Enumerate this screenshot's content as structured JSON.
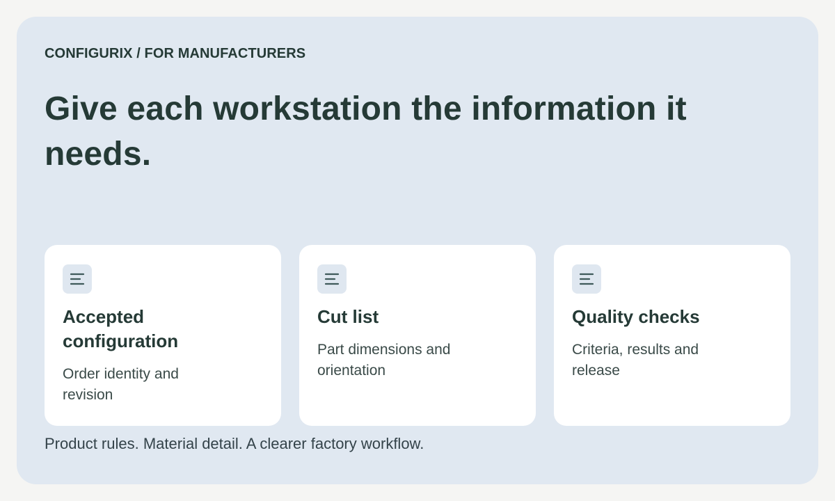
{
  "header": {
    "eyebrow": "CONFIGURIX / FOR MANUFACTURERS",
    "headline": "Give each workstation the information it needs."
  },
  "cards": [
    {
      "icon": "list-lines-icon",
      "title": "Accepted configuration",
      "description": "Order identity and revision"
    },
    {
      "icon": "list-lines-icon",
      "title": "Cut list",
      "description": "Part dimensions and orientation"
    },
    {
      "icon": "list-lines-icon",
      "title": "Quality checks",
      "description": "Criteria, results and release"
    }
  ],
  "footer": {
    "tagline": "Product rules. Material detail. A clearer factory workflow."
  },
  "colors": {
    "page_background": "#f5f5f3",
    "panel_background": "#e0e8f1",
    "card_background": "#ffffff",
    "text_dark": "#253a36",
    "icon_stroke": "#3f5a5a"
  }
}
